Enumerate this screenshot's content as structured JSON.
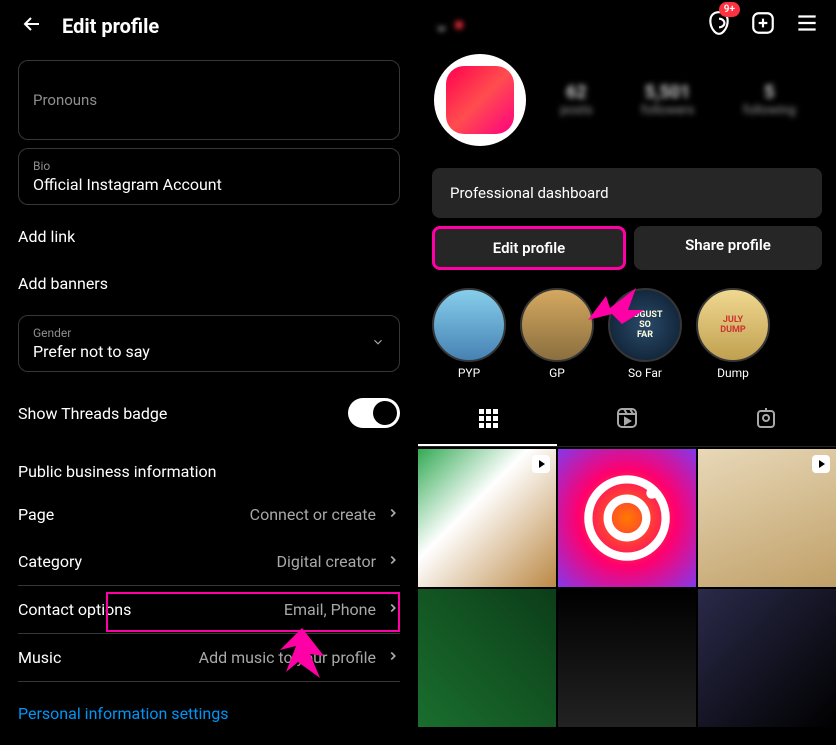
{
  "left": {
    "title": "Edit profile",
    "fields": {
      "pronouns_label": "Pronouns",
      "bio_label": "Bio",
      "bio_value": "Official Instagram Account",
      "gender_label": "Gender",
      "gender_value": "Prefer not to say"
    },
    "add_link": "Add link",
    "add_banners": "Add banners",
    "threads_badge": "Show Threads badge",
    "section_title": "Public business information",
    "rows": {
      "page_label": "Page",
      "page_value": "Connect or create",
      "category_label": "Category",
      "category_value": "Digital creator",
      "contact_label": "Contact options",
      "contact_value": "Email, Phone",
      "music_label": "Music",
      "music_value": "Add music to your profile"
    },
    "personal_info": "Personal information settings"
  },
  "right": {
    "badge": "9+",
    "stats": {
      "posts_num": "62",
      "posts_label": "posts",
      "followers_num": "5,501",
      "followers_label": "followers",
      "following_num": "5",
      "following_label": "following"
    },
    "dashboard": "Professional dashboard",
    "edit_profile": "Edit profile",
    "share_profile": "Share profile",
    "highlights": [
      {
        "label": "PYP"
      },
      {
        "label": "GP"
      },
      {
        "label": "So Far"
      },
      {
        "label": "Dump"
      }
    ]
  },
  "colors": {
    "highlight": "#ff00a6",
    "link": "#0095f6"
  }
}
